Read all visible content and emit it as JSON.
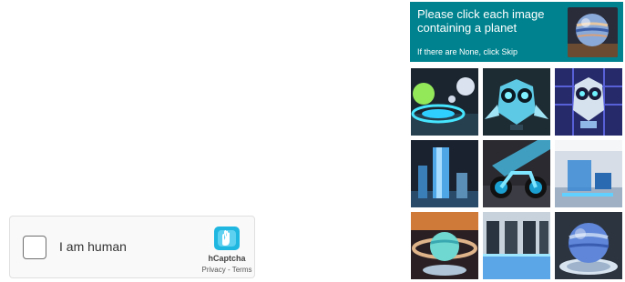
{
  "challenge": {
    "prompt": "Please click each image containing a planet",
    "hint": "If there are None, click Skip",
    "example_icon": "planet-example-image",
    "header_color": "#00838f",
    "tiles": [
      {
        "icon": "holographic-orb-rings-image"
      },
      {
        "icon": "robot-owl-image"
      },
      {
        "icon": "circuit-owl-image"
      },
      {
        "icon": "glass-towers-image"
      },
      {
        "icon": "neon-motorcycle-image"
      },
      {
        "icon": "futuristic-room-cube-image"
      },
      {
        "icon": "ringed-planet-image"
      },
      {
        "icon": "neon-interior-room-image"
      },
      {
        "icon": "planet-in-bowl-image"
      }
    ]
  },
  "widget": {
    "checkbox_label": "I am human",
    "brand": "hCaptcha",
    "privacy_link": "Privacy",
    "separator": " - ",
    "terms_link": "Terms"
  }
}
